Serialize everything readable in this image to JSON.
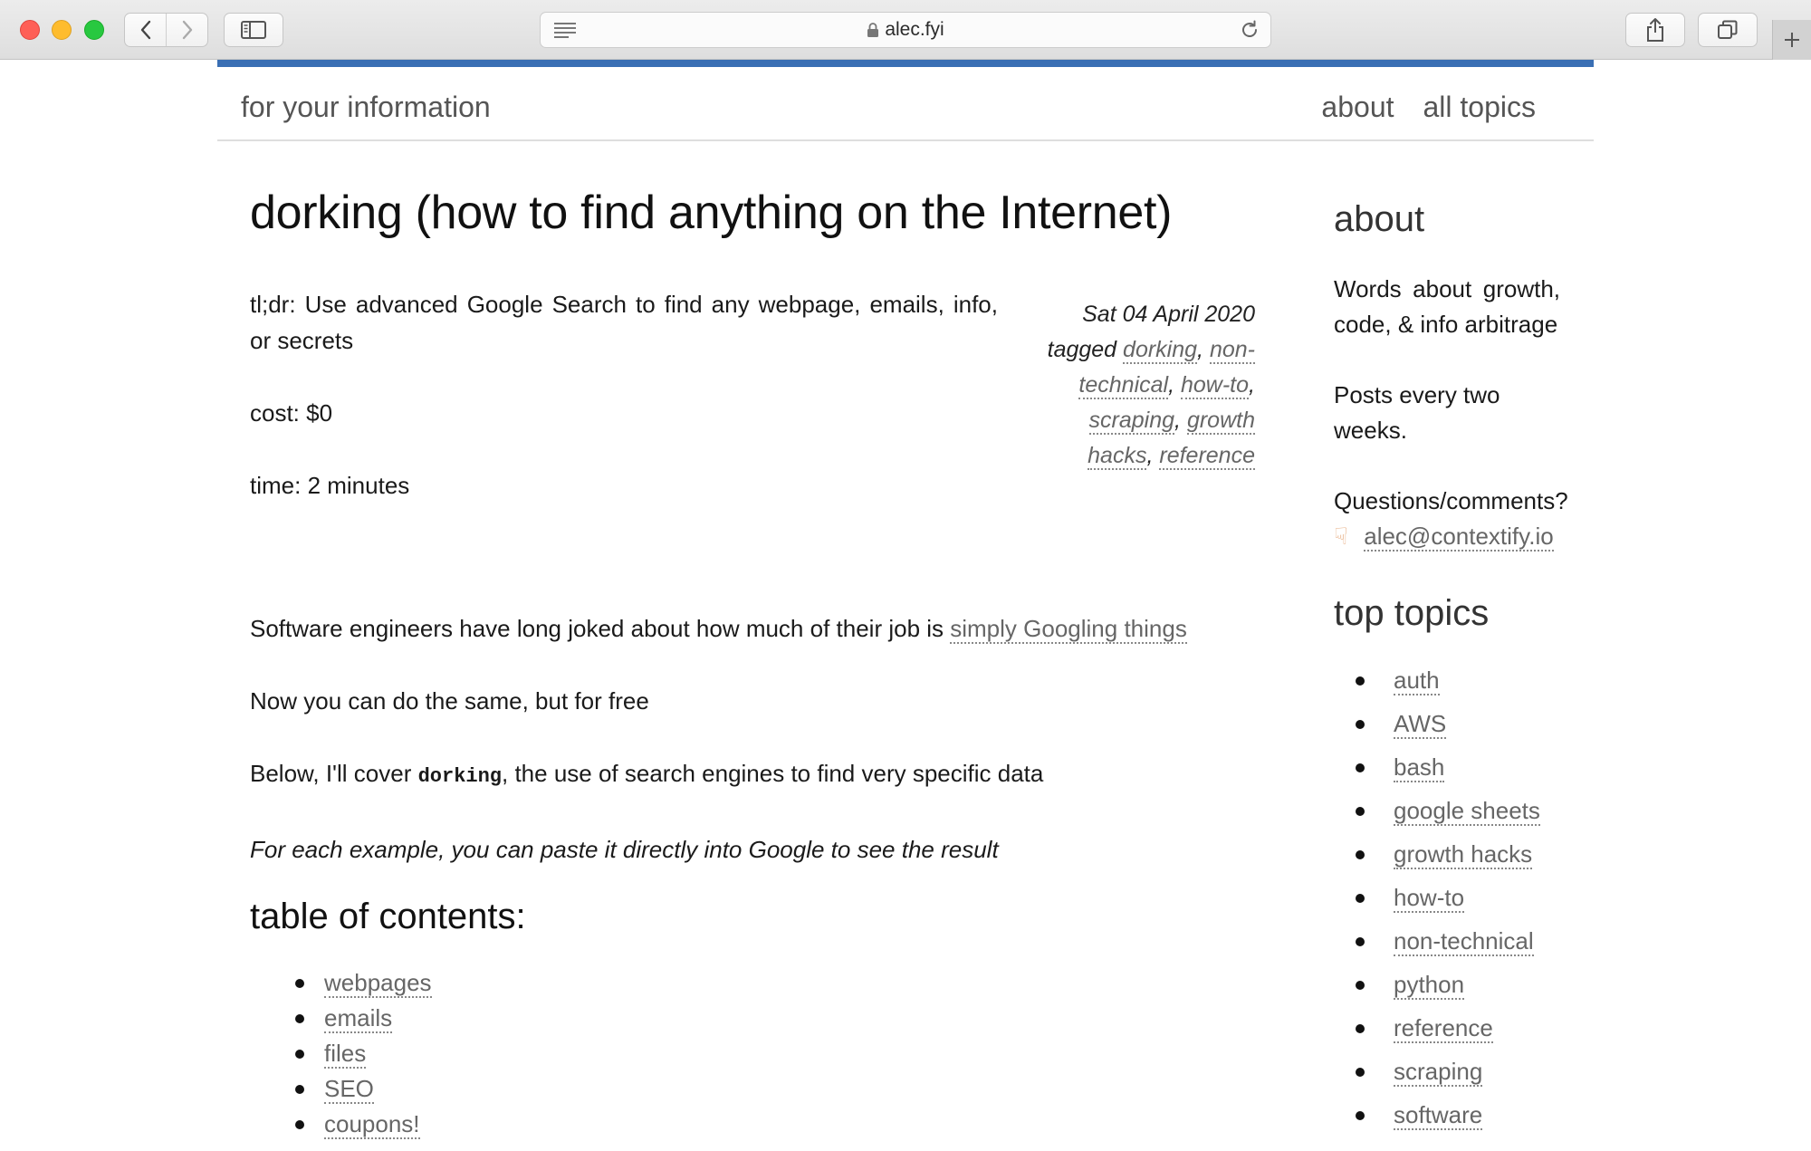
{
  "browser": {
    "url": "alec.fyi"
  },
  "header": {
    "brand": "for your information",
    "nav": [
      "about",
      "all topics"
    ]
  },
  "post": {
    "title": "dorking (how to find anything on the Internet)",
    "tldr": "tl;dr: Use advanced Google Search to find any webpage, emails, info, or secrets",
    "cost": "cost: $0",
    "time": "time: 2 minutes",
    "meta": {
      "date": "Sat 04 April 2020",
      "tagged_label": "tagged",
      "tags": [
        "dorking",
        "non-technical",
        "how-to",
        "scraping",
        "growth hacks",
        "reference"
      ]
    },
    "p1_text": "Software engineers have long joked about how much of their job is ",
    "p1_link": "simply Googling things",
    "p2": "Now you can do the same, but for free",
    "p3_before": "Below, I'll cover ",
    "p3_code": "dorking",
    "p3_after": ", the use of search engines to find very specific data",
    "p4": "For each example, you can paste it directly into Google to see the result",
    "toc_heading": "table of contents:",
    "toc": [
      "webpages",
      "emails",
      "files",
      "SEO",
      "coupons!"
    ]
  },
  "sidebar": {
    "about_heading": "about",
    "about_text": "Words about growth, code, & info arbitrage",
    "schedule": "Posts every two weeks.",
    "questions": "Questions/comments?",
    "hand_icon": "pointing-down-icon",
    "email": "alec@contextify.io",
    "topics_heading": "top topics",
    "topics": [
      "auth",
      "AWS",
      "bash",
      "google sheets",
      "growth hacks",
      "how-to",
      "non-technical",
      "python",
      "reference",
      "scraping",
      "software"
    ]
  }
}
